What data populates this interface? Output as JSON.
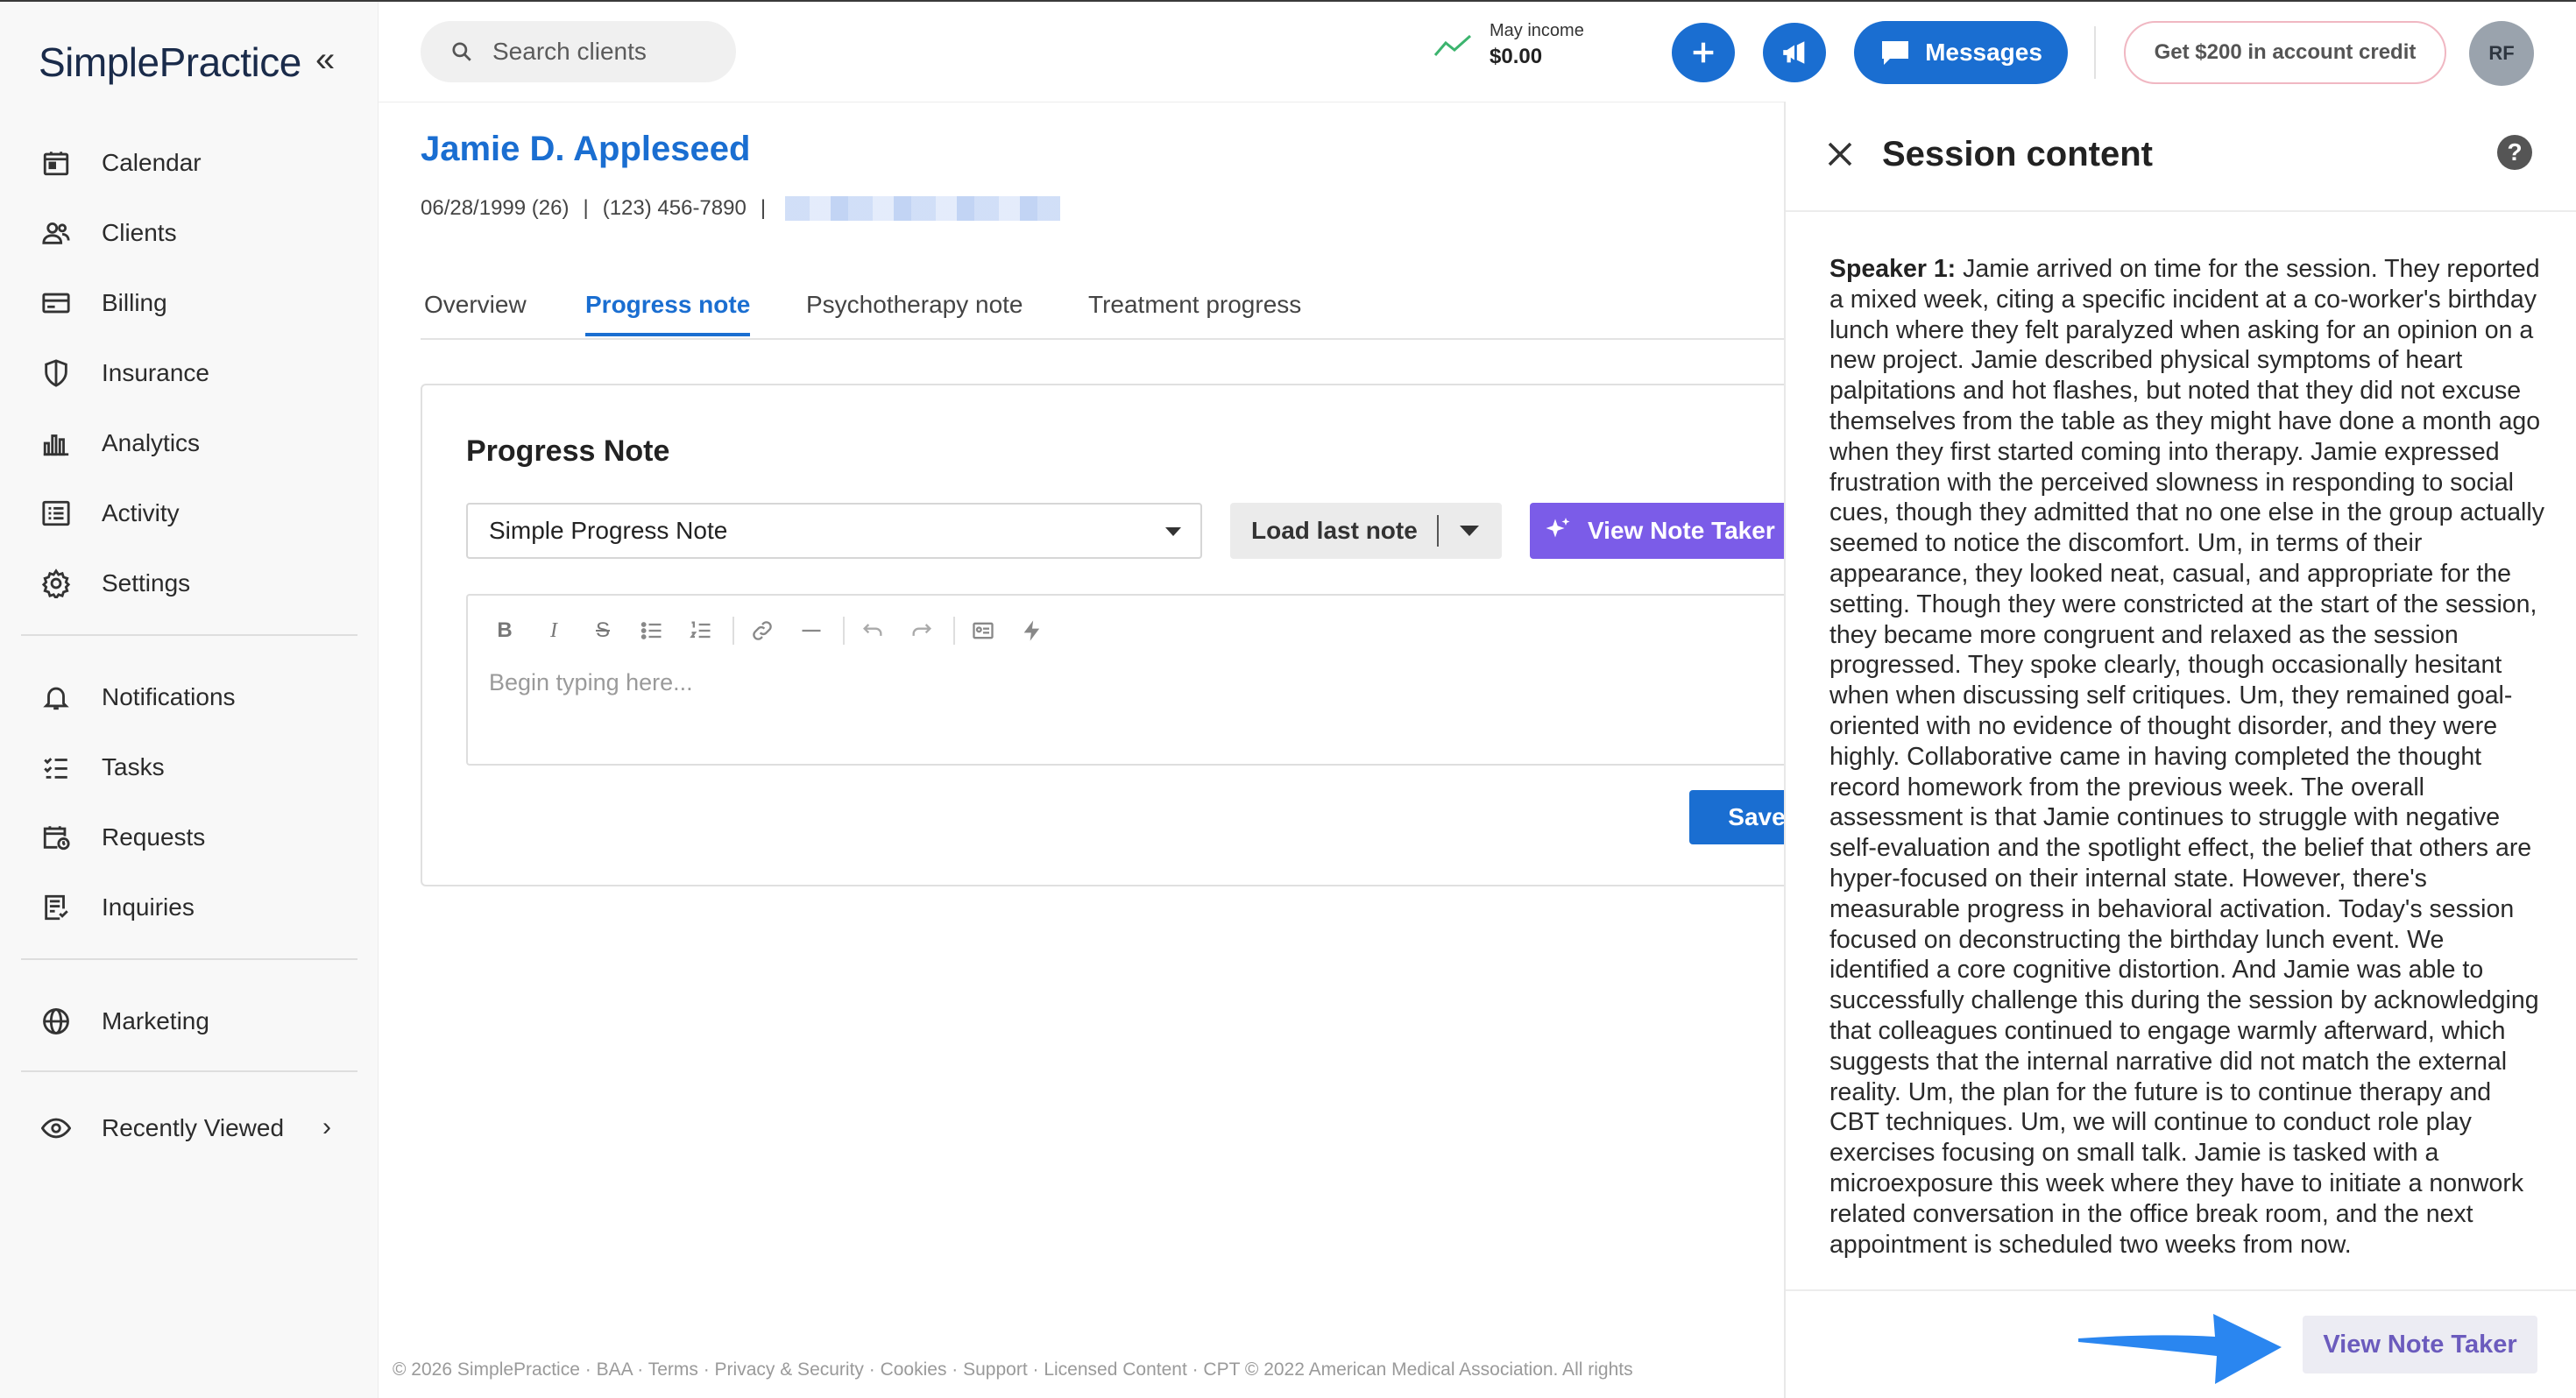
{
  "sidebar": {
    "logo": "SimplePractice",
    "collapse_glyph": "«",
    "items": [
      {
        "label": "Calendar",
        "icon": "calendar-icon"
      },
      {
        "label": "Clients",
        "icon": "clients-icon"
      },
      {
        "label": "Billing",
        "icon": "billing-icon"
      },
      {
        "label": "Insurance",
        "icon": "shield-icon"
      },
      {
        "label": "Analytics",
        "icon": "bar-chart-icon"
      },
      {
        "label": "Activity",
        "icon": "activity-list-icon"
      },
      {
        "label": "Settings",
        "icon": "gear-icon"
      },
      {
        "label": "Notifications",
        "icon": "bell-icon"
      },
      {
        "label": "Tasks",
        "icon": "tasks-icon"
      },
      {
        "label": "Requests",
        "icon": "calendar-clock-icon"
      },
      {
        "label": "Inquiries",
        "icon": "inquiries-icon"
      },
      {
        "label": "Marketing",
        "icon": "globe-icon"
      },
      {
        "label": "Recently Viewed",
        "icon": "eye-icon"
      }
    ]
  },
  "header": {
    "search_placeholder": "Search clients",
    "income_label": "May income",
    "income_value": "$0.00",
    "messages_label": "Messages",
    "credit_label": "Get $200 in account credit",
    "avatar_initials": "RF"
  },
  "client": {
    "name": "Jamie D. Appleseed",
    "dob": "06/28/1999 (26)",
    "phone": "(123) 456-7890",
    "separator": "|"
  },
  "tabs": [
    {
      "label": "Overview",
      "active": false
    },
    {
      "label": "Progress note",
      "active": true
    },
    {
      "label": "Psychotherapy note",
      "active": false
    },
    {
      "label": "Treatment progress",
      "active": false
    }
  ],
  "note": {
    "title": "Progress Note",
    "template_selected": "Simple Progress Note",
    "load_last_label": "Load last note",
    "view_note_taker_label": "View Note Taker",
    "editor_placeholder": "Begin typing here...",
    "save_label": "Save"
  },
  "footer": "© 2026 SimplePractice · BAA · Terms · Privacy & Security · Cookies · Support · Licensed Content · CPT © 2022 American Medical Association. All rights",
  "drawer": {
    "title": "Session content",
    "help_glyph": "?",
    "speaker": "Speaker 1:",
    "transcript": "Jamie arrived on time for the session. They reported a mixed week, citing a specific incident at a co-worker's birthday lunch where they felt paralyzed when asking for an opinion on a new project. Jamie described physical symptoms of heart palpitations and hot flashes, but noted that they did not excuse themselves from the table as they might have done a month ago when they first started coming into therapy. Jamie expressed frustration with the perceived slowness in responding to social cues, though they admitted that no one else in the group actually seemed to notice the discomfort. Um, in terms of their appearance, they looked neat, casual, and appropriate for the setting. Though they were constricted at the start of the session, they became more congruent and relaxed as the session progressed. They spoke clearly, though occasionally hesitant when when discussing self critiques. Um, they remained goal-oriented with no evidence of thought disorder, and they were highly. Collaborative came in having completed the thought record homework from the previous week. The overall assessment is that Jamie continues to struggle with negative self-evaluation and the spotlight effect, the belief that others are hyper-focused on their internal state. However, there's measurable progress in behavioral activation. Today's session focused on deconstructing the birthday lunch event. We identified a core cognitive distortion. And Jamie was able to successfully challenge this during the session by acknowledging that colleagues continued to engage warmly afterward, which suggests that the internal narrative did not match the external reality. Um, the plan for the future is to continue therapy and CBT techniques. Um, we will continue to conduct role play exercises focusing on small talk. Jamie is tasked with a microexposure this week where they have to initiate a nonwork related conversation in the office break room, and the next appointment is scheduled two weeks from now.",
    "view_note_taker_label": "View Note Taker"
  },
  "colors": {
    "primary_blue": "#1a6ed1",
    "purple": "#7b5ce8",
    "purple_text": "#6b5bbd",
    "arrow_blue": "#2a86f0"
  }
}
